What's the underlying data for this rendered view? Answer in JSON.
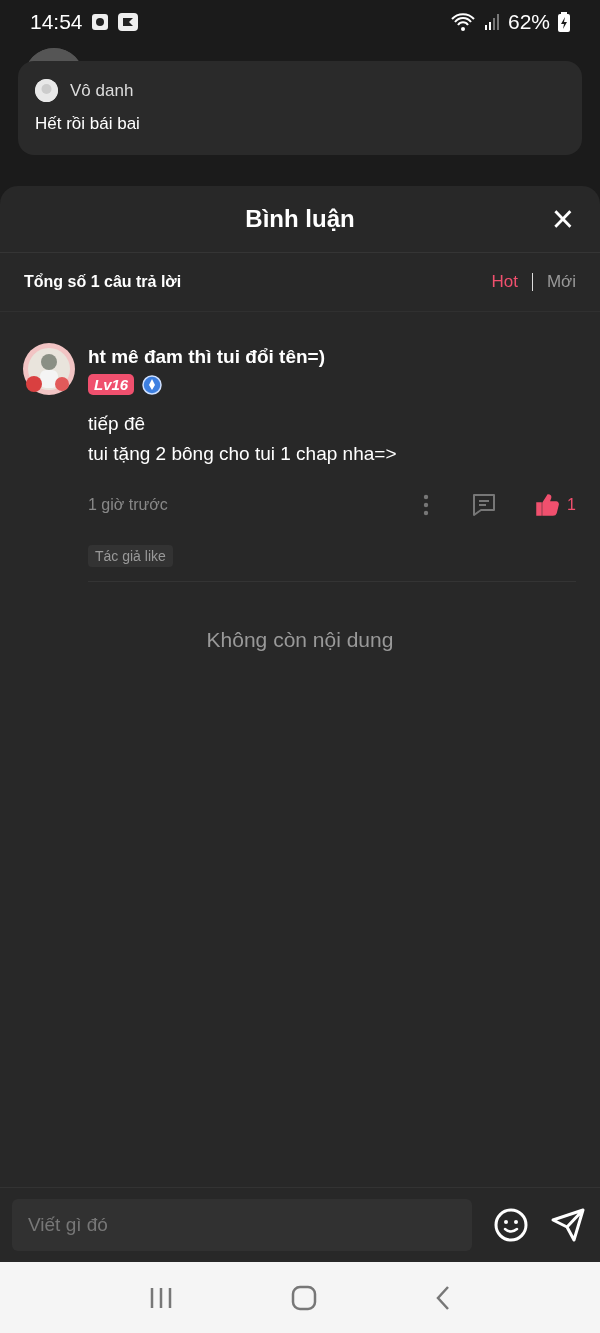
{
  "status_bar": {
    "time": "14:54",
    "battery": "62%"
  },
  "toast": {
    "sender": "Vô danh",
    "message": "Hết rồi bái bai"
  },
  "sheet": {
    "title": "Bình luận",
    "close": "×"
  },
  "summary": {
    "total": "Tổng số 1 câu trả lời",
    "sort": [
      {
        "label": "Hot",
        "selected": true
      },
      {
        "label": "Mới",
        "selected": false
      }
    ]
  },
  "comments": [
    {
      "name": "ht mê đam thì tui đổi tên=)",
      "level": "Lv16",
      "lines": [
        "tiếp đê",
        "tui tặng 2 bông cho tui 1 chap nha=>"
      ],
      "time": "1 giờ trước",
      "liked": true,
      "likes": "1",
      "tag": "Tác giả like"
    }
  ],
  "end_note": "Không còn nội dung",
  "composer": {
    "placeholder": "Viết gì đó"
  }
}
